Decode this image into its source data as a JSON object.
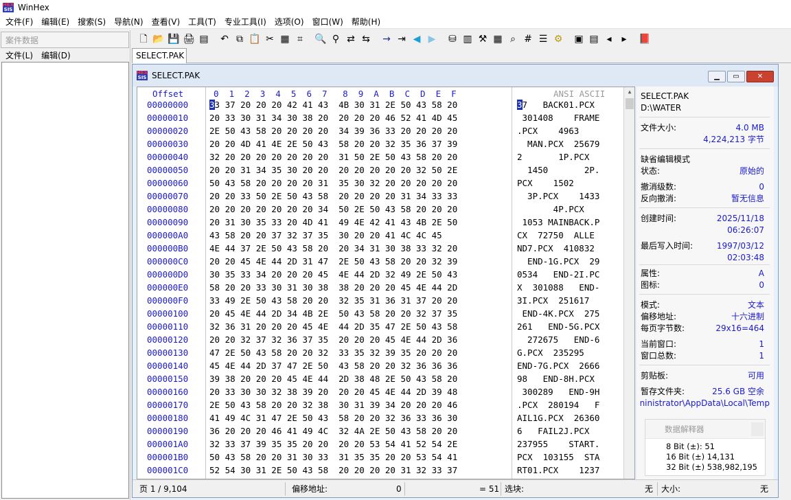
{
  "app": {
    "title": "WinHex",
    "logo_top": "HEX",
    "logo_bottom": "SIS"
  },
  "menu": [
    "文件(F)",
    "编辑(E)",
    "搜索(S)",
    "导航(N)",
    "查看(V)",
    "工具(T)",
    "专业工具(I)",
    "选项(O)",
    "窗口(W)",
    "帮助(H)"
  ],
  "left_panel": {
    "header": "案件数据",
    "menu": [
      "文件(L)",
      "编辑(D)"
    ]
  },
  "toolbar_icons": [
    "new-file-icon",
    "open-folder-icon",
    "save-icon",
    "print-icon",
    "properties-icon",
    "gap",
    "undo-icon",
    "copy-icon",
    "paste-icon",
    "cut-icon",
    "paste-special-icon",
    "hex-write-icon",
    "gap",
    "find-text-icon",
    "find-hex-icon",
    "replace-text-icon",
    "replace-hex-icon",
    "gap",
    "goto-offset-icon",
    "goto-block-icon",
    "back-icon",
    "forward-icon",
    "gap",
    "disk-icon",
    "ram-icon",
    "tools-icon",
    "calculator-icon",
    "zoom-icon",
    "hash-icon",
    "options-icon",
    "gear-icon",
    "gap",
    "view-icon",
    "layout-icon",
    "prev-icon",
    "next-icon",
    "gap",
    "book-icon"
  ],
  "tab": {
    "label": "SELECT.PAK"
  },
  "editor_window": {
    "title": "SELECT.PAK",
    "header": {
      "offset": "Offset",
      "columns": [
        "0",
        "1",
        "2",
        "3",
        "4",
        "5",
        "6",
        "7",
        "8",
        "9",
        "A",
        "B",
        "C",
        "D",
        "E",
        "F"
      ],
      "ascii": "ANSI ASCII"
    },
    "rows": [
      {
        "off": "00000000",
        "hex": "33 37 20 20 20 42 41 43  4B 30 31 2E 50 43 58 20",
        "asc": "37   BACK01.PCX "
      },
      {
        "off": "00000010",
        "hex": "20 33 30 31 34 30 38 20  20 20 20 46 52 41 4D 45",
        "asc": " 301408    FRAME"
      },
      {
        "off": "00000020",
        "hex": "2E 50 43 58 20 20 20 20  34 39 36 33 20 20 20 20",
        "asc": ".PCX    4963    "
      },
      {
        "off": "00000030",
        "hex": "20 20 4D 41 4E 2E 50 43  58 20 20 32 35 36 37 39",
        "asc": "  MAN.PCX  25679"
      },
      {
        "off": "00000040",
        "hex": "32 20 20 20 20 20 20 20  31 50 2E 50 43 58 20 20",
        "asc": "2       1P.PCX  "
      },
      {
        "off": "00000050",
        "hex": "20 20 31 34 35 30 20 20  20 20 20 20 20 32 50 2E",
        "asc": "  1450       2P."
      },
      {
        "off": "00000060",
        "hex": "50 43 58 20 20 20 20 31  35 30 32 20 20 20 20 20",
        "asc": "PCX    1502     "
      },
      {
        "off": "00000070",
        "hex": "20 20 33 50 2E 50 43 58  20 20 20 20 31 34 33 33",
        "asc": "  3P.PCX    1433"
      },
      {
        "off": "00000080",
        "hex": "20 20 20 20 20 20 20 34  50 2E 50 43 58 20 20 20",
        "asc": "       4P.PCX   "
      },
      {
        "off": "00000090",
        "hex": "20 31 30 35 33 20 4D 41  49 4E 42 41 43 4B 2E 50",
        "asc": " 1053 MAINBACK.P"
      },
      {
        "off": "000000A0",
        "hex": "43 58 20 20 37 32 37 35  30 20 20 41 4C 4C 45",
        "asc": "CX  72750  ALLE"
      },
      {
        "off": "000000B0",
        "hex": "4E 44 37 2E 50 43 58 20  20 34 31 30 38 33 32 20",
        "asc": "ND7.PCX  410832 "
      },
      {
        "off": "000000C0",
        "hex": "20 20 45 4E 44 2D 31 47  2E 50 43 58 20 20 32 39",
        "asc": "  END-1G.PCX  29"
      },
      {
        "off": "000000D0",
        "hex": "30 35 33 34 20 20 20 45  4E 44 2D 32 49 2E 50 43",
        "asc": "0534   END-2I.PC"
      },
      {
        "off": "000000E0",
        "hex": "58 20 20 33 30 31 30 38  38 20 20 20 45 4E 44 2D",
        "asc": "X  301088   END-"
      },
      {
        "off": "000000F0",
        "hex": "33 49 2E 50 43 58 20 20  32 35 31 36 31 37 20 20",
        "asc": "3I.PCX  251617  "
      },
      {
        "off": "00000100",
        "hex": "20 45 4E 44 2D 34 4B 2E  50 43 58 20 20 32 37 35",
        "asc": " END-4K.PCX  275"
      },
      {
        "off": "00000110",
        "hex": "32 36 31 20 20 20 45 4E  44 2D 35 47 2E 50 43 58",
        "asc": "261   END-5G.PCX"
      },
      {
        "off": "00000120",
        "hex": "20 20 32 37 32 36 37 35  20 20 20 45 4E 44 2D 36",
        "asc": "  272675   END-6"
      },
      {
        "off": "00000130",
        "hex": "47 2E 50 43 58 20 20 32  33 35 32 39 35 20 20 20",
        "asc": "G.PCX  235295   "
      },
      {
        "off": "00000140",
        "hex": "45 4E 44 2D 37 47 2E 50  43 58 20 20 32 36 36 36",
        "asc": "END-7G.PCX  2666"
      },
      {
        "off": "00000150",
        "hex": "39 38 20 20 20 45 4E 44  2D 38 48 2E 50 43 58 20",
        "asc": "98   END-8H.PCX "
      },
      {
        "off": "00000160",
        "hex": "20 33 30 30 32 38 39 20  20 20 45 4E 44 2D 39 48",
        "asc": " 300289   END-9H"
      },
      {
        "off": "00000170",
        "hex": "2E 50 43 58 20 20 32 38  30 31 39 34 20 20 20 46",
        "asc": ".PCX  280194   F"
      },
      {
        "off": "00000180",
        "hex": "41 49 4C 31 47 2E 50 43  58 20 20 32 36 33 36 30",
        "asc": "AIL1G.PCX  26360"
      },
      {
        "off": "00000190",
        "hex": "36 20 20 20 46 41 49 4C  32 4A 2E 50 43 58 20 20",
        "asc": "6   FAIL2J.PCX  "
      },
      {
        "off": "000001A0",
        "hex": "32 33 37 39 35 35 20 20  20 20 53 54 41 52 54 2E",
        "asc": "237955    START."
      },
      {
        "off": "000001B0",
        "hex": "50 43 58 20 20 31 30 33  31 35 35 20 20 53 54 41",
        "asc": "PCX  103155  STA"
      },
      {
        "off": "000001C0",
        "hex": "52 54 30 31 2E 50 43 58  20 20 20 20 31 32 33 37",
        "asc": "RT01.PCX    1237"
      }
    ]
  },
  "info": {
    "file_name": "SELECT.PAK",
    "file_path": "D:\\WATER",
    "size_label": "文件大小:",
    "size_mb": "4.0 MB",
    "size_bytes": "4,224,213 字节",
    "edit_mode_title": "缺省编辑模式",
    "state_label": "状态:",
    "state_value": "原始的",
    "undo_level_label": "撤消级数:",
    "undo_level_value": "0",
    "reverse_undo_label": "反向撤消:",
    "reverse_undo_value": "暂无信息",
    "created_label": "创建时间:",
    "created_date": "2025/11/18",
    "created_time": "06:26:07",
    "modified_label": "最后写入时间:",
    "modified_date": "1997/03/12",
    "modified_time": "02:03:48",
    "attr_label": "属性:",
    "attr_value": "A",
    "icon_label": "图标:",
    "icon_value": "0",
    "mode_label": "模式:",
    "mode_value": "文本",
    "offset_label": "偏移地址:",
    "offset_value": "十六进制",
    "bpp_label": "每页字节数:",
    "bpp_value": "29x16=464",
    "cur_win_label": "当前窗口:",
    "cur_win_value": "1",
    "win_total_label": "窗口总数:",
    "win_total_value": "1",
    "clipboard_label": "剪贴板:",
    "clipboard_value": "可用",
    "temp_label": "暂存文件夹:",
    "temp_value": "25.6 GB 空余",
    "temp_path": "ninistrator\\AppData\\Local\\Temp",
    "interp_title": "数据解释器",
    "interp_8": "8 Bit (±): 51",
    "interp_16": "16 Bit (±) 14,131",
    "interp_32": "32 Bit (±) 538,982,195"
  },
  "status": {
    "page": "页 1 / 9,104",
    "offset_label": "偏移地址:",
    "offset_value": "0",
    "eq_value": "= 51",
    "select_label": "选块:",
    "select_value": "无",
    "size_label": "大小:",
    "size_value": "无"
  },
  "colors": {
    "offset_blue": "#1a1acd",
    "cursor": "#1c2fb8",
    "info_value": "#1a1ad0",
    "close_red": "#c9422f"
  }
}
